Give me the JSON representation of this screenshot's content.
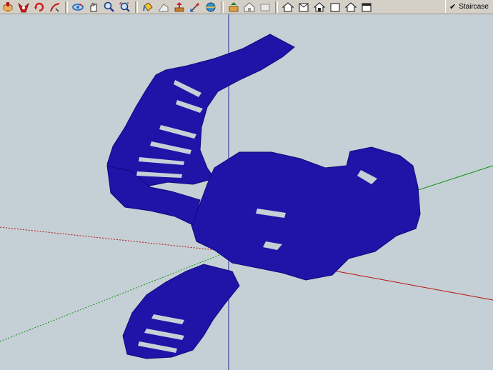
{
  "toolbar": {
    "tools": [
      {
        "icon": "make-component-icon"
      },
      {
        "icon": "erase-icon"
      },
      {
        "icon": "rotate-icon"
      },
      {
        "icon": "follow-me-icon"
      },
      {
        "icon": "orbit-icon"
      },
      {
        "icon": "pan-icon"
      },
      {
        "icon": "zoom-icon"
      },
      {
        "icon": "zoom-extents-icon"
      },
      {
        "icon": "paint-bucket-icon"
      },
      {
        "icon": "eraser-shape-icon"
      },
      {
        "icon": "push-pull-icon"
      },
      {
        "icon": "tape-measure-icon"
      },
      {
        "icon": "sandbox-icon"
      },
      {
        "icon": "upload-icon"
      },
      {
        "icon": "warehouse-icon"
      },
      {
        "icon": "hide-icon"
      }
    ],
    "views": [
      {
        "icon": "iso-view-icon"
      },
      {
        "icon": "top-view-icon"
      },
      {
        "icon": "front-view-icon"
      },
      {
        "icon": "right-view-icon"
      },
      {
        "icon": "back-view-icon"
      },
      {
        "icon": "left-view-icon"
      }
    ]
  },
  "scene_tab": {
    "checked": true,
    "label": "Staircase"
  },
  "colors": {
    "background": "#c5d0d6",
    "model_fill": "#1f14a8",
    "model_dark": "#10087a",
    "axis_blue": "#1a2aa0",
    "axis_red": "#b81010",
    "axis_green": "#109010"
  }
}
